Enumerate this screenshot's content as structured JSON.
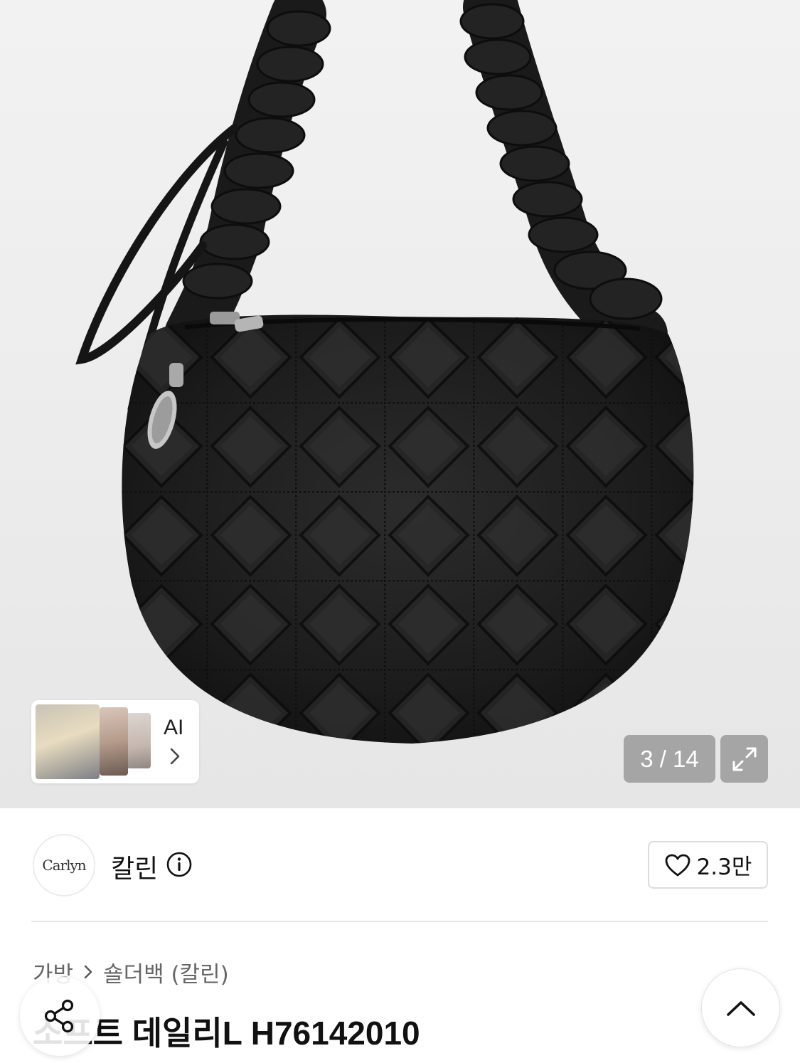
{
  "gallery": {
    "image_alt": "black quilted shoulder bag",
    "current_page": "3",
    "total_pages": "14",
    "counter_text": "3 / 14",
    "ai_label": "AI"
  },
  "brand": {
    "logo_text": "Carlyn",
    "name": "칼린",
    "like_count": "2.3만"
  },
  "breadcrumb": {
    "items": [
      "가방",
      "숄더백 (칼린)"
    ]
  },
  "product": {
    "title": "소프트 데일리L H76142010"
  },
  "icons": {
    "ai_arrow": "chevron-right-icon",
    "expand": "expand-icon",
    "info": "info-icon",
    "like": "heart-icon",
    "share": "share-icon",
    "scroll_top": "chevron-up-icon"
  }
}
